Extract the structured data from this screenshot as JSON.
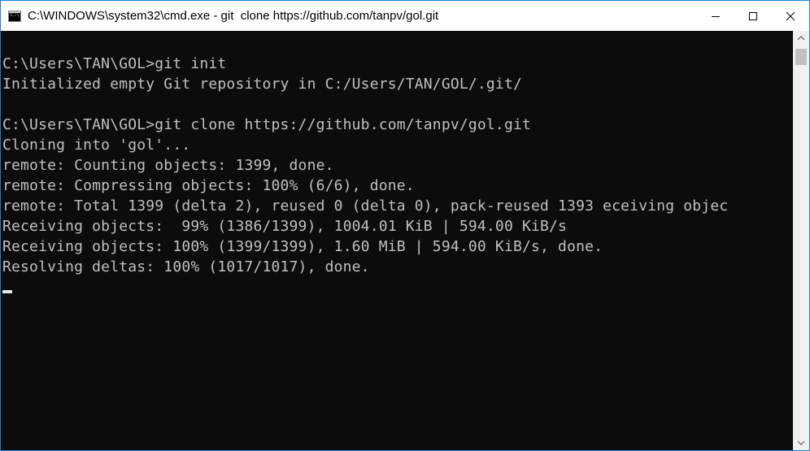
{
  "window": {
    "title": "C:\\WINDOWS\\system32\\cmd.exe - git  clone https://github.com/tanpv/gol.git",
    "icon": "cmd-icon",
    "icon_text": "C:\\",
    "buttons": {
      "minimize": "minimize-icon",
      "maximize": "maximize-icon",
      "close": "close-icon"
    },
    "border_color": "#1883d7"
  },
  "terminal": {
    "background": "#0c0c0c",
    "foreground": "#c0c0c0",
    "lines": [
      "C:\\Users\\TAN\\GOL>git init",
      "Initialized empty Git repository in C:/Users/TAN/GOL/.git/",
      "",
      "C:\\Users\\TAN\\GOL>git clone https://github.com/tanpv/gol.git",
      "Cloning into 'gol'...",
      "remote: Counting objects: 1399, done.",
      "remote: Compressing objects: 100% (6/6), done.",
      "remote: Total 1399 (delta 2), reused 0 (delta 0), pack-reused 1393 eceiving objec",
      "Receiving objects:  99% (1386/1399), 1004.01 KiB | 594.00 KiB/s",
      "Receiving objects: 100% (1399/1399), 1.60 MiB | 594.00 KiB/s, done.",
      "Resolving deltas: 100% (1017/1017), done."
    ]
  },
  "scrollbar": {
    "up_icon": "scroll-up-arrow-icon",
    "down_icon": "scroll-down-arrow-icon"
  }
}
